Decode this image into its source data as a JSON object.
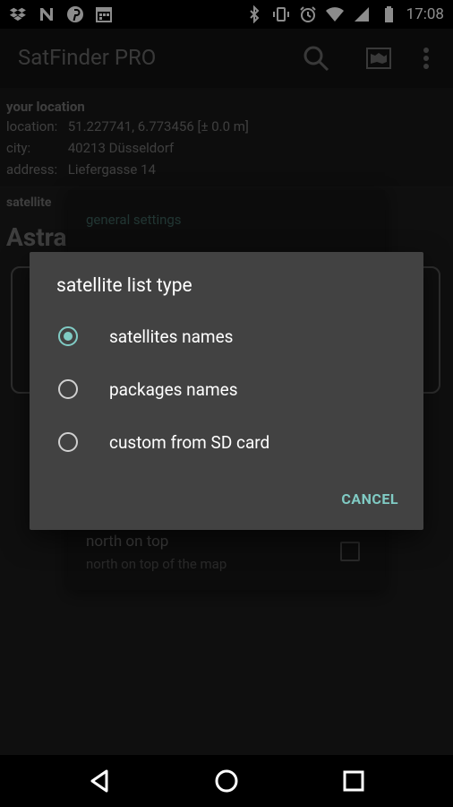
{
  "status_bar": {
    "time": "17:08",
    "left_icons": [
      "dropbox-icon",
      "n-icon",
      "pinterest-icon",
      "calendar-icon"
    ],
    "right_icons": [
      "bluetooth-icon",
      "vibrate-icon",
      "alarm-icon",
      "wifi-icon",
      "signal-icon",
      "battery-icon"
    ]
  },
  "appbar": {
    "title": "SatFinder PRO",
    "actions": [
      "search-icon",
      "map-icon",
      "overflow-menu-icon"
    ]
  },
  "location": {
    "header": "your location",
    "location_label": "location:",
    "location_value": "51.227741, 6.773456 [± 0.0 m]",
    "city_label": "city:",
    "city_value": "40213 Düsseldorf",
    "address_label": "address:",
    "address_value": "Liefergasse 14"
  },
  "satellite": {
    "label": "satellite",
    "value": "Astra"
  },
  "settings": {
    "header": "general settings",
    "north_title": "north on top",
    "north_subtitle": "north on top of the map",
    "north_checked": false
  },
  "dialog": {
    "title": "satellite list type",
    "options": [
      {
        "label": "satellites names",
        "selected": true
      },
      {
        "label": "packages names",
        "selected": false
      },
      {
        "label": "custom from SD card",
        "selected": false
      }
    ],
    "cancel_label": "CANCEL"
  },
  "navbar": {
    "buttons": [
      "back-icon",
      "home-icon",
      "recents-icon"
    ]
  },
  "colors": {
    "accent": "#80cbc4",
    "dialog_bg": "#424242",
    "app_bg": "#1c1c1c"
  }
}
